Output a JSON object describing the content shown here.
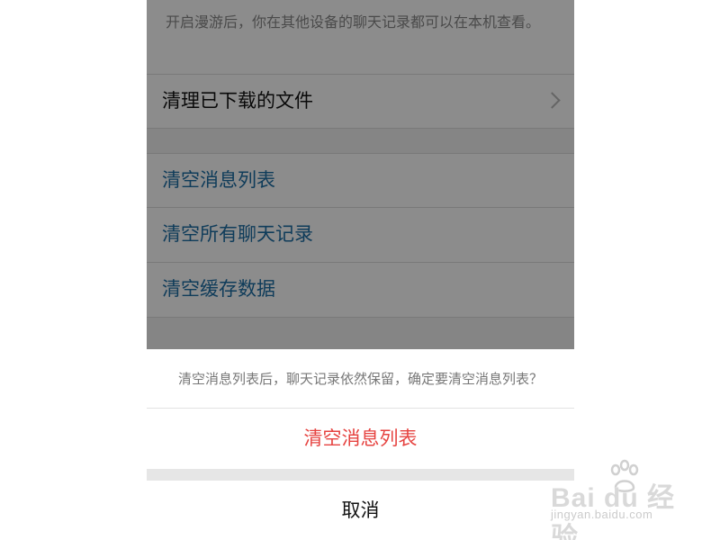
{
  "settings": {
    "roaming_description": "开启漫游后，你在其他设备的聊天记录都可以在本机查看。",
    "rows": [
      {
        "label": "清理已下载的文件",
        "has_chevron": true
      },
      {
        "label": "清空消息列表"
      },
      {
        "label": "清空所有聊天记录"
      },
      {
        "label": "清空缓存数据"
      }
    ]
  },
  "action_sheet": {
    "message": "清空消息列表后，聊天记录依然保留，确定要清空消息列表？",
    "confirm_label": "清空消息列表",
    "cancel_label": "取消"
  },
  "watermark": {
    "logo_text": "Bai du 经验",
    "url_text": "jingyan.baidu.com"
  },
  "colors": {
    "action_blue": "#1d6ea5",
    "destructive_red": "#e64340",
    "overlay": "rgba(0,0,0,0.45)"
  }
}
